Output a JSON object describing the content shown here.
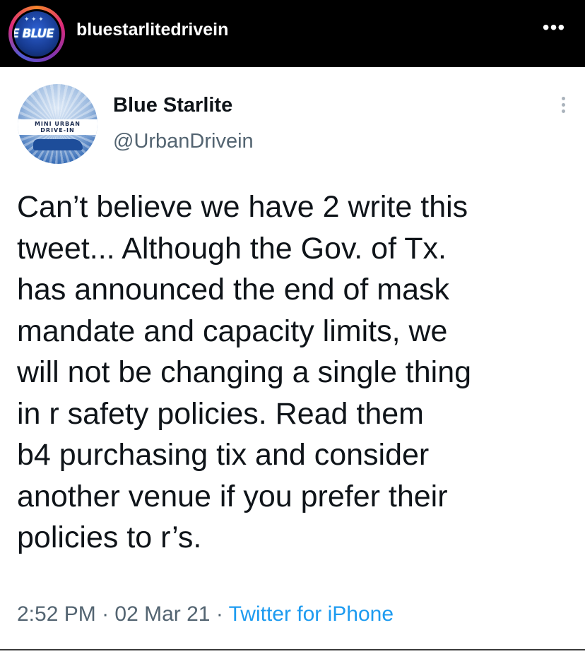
{
  "instagram": {
    "username": "bluestarlitedrivein",
    "avatar_text": "E BLUE",
    "more_icon": "•••"
  },
  "tweet": {
    "display_name": "Blue Starlite",
    "handle": "@UrbanDrivein",
    "avatar_text": "MINI URBAN DRIVE-IN",
    "text_lines": [
      "Can’t believe we have 2 write this",
      "tweet... Although the Gov. of Tx.",
      "has announced the end of mask",
      "mandate and capacity limits, we",
      "will not be changing a single thing",
      "in r safety policies. Read them",
      "b4 purchasing tix and consider",
      "another venue if you prefer their",
      "policies to r’s."
    ],
    "time": "2:52 PM",
    "separator": " · ",
    "date": "02 Mar 21",
    "source": "Twitter for iPhone"
  }
}
